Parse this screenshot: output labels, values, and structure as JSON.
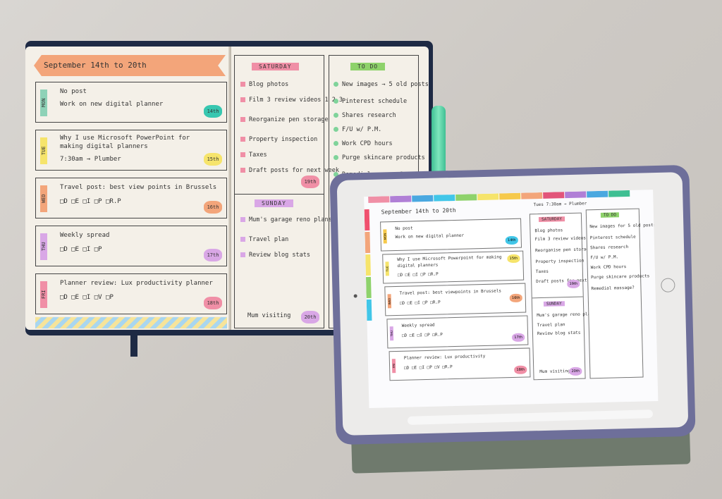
{
  "notebook": {
    "banner": "September 14th to 20th",
    "days": [
      {
        "tag": "MON",
        "color": "#8ed2b7",
        "lines": [
          "No post",
          "Work on new digital planner"
        ],
        "date": "14th",
        "dateColor": "#37c7b0"
      },
      {
        "tag": "TUE",
        "color": "#f6e46b",
        "lines": [
          "Why I use Microsoft PowerPoint for",
          "making digital planners",
          "7:30am → Plumber"
        ],
        "date": "15th",
        "dateColor": "#f6e46b"
      },
      {
        "tag": "WED",
        "color": "#f3a57a",
        "lines": [
          "Travel post: best view points in Brussels",
          "□D  □E  □I  □P  □R.P"
        ],
        "date": "16th",
        "dateColor": "#f3a57a"
      },
      {
        "tag": "THU",
        "color": "#d9a7e6",
        "lines": [
          "Weekly spread",
          "□D  □E  □I  □P"
        ],
        "date": "17th",
        "dateColor": "#d9a7e6"
      },
      {
        "tag": "FRI",
        "color": "#f08fa6",
        "lines": [
          "Planner review: Lux productivity planner",
          "□D  □E  □I  □V  □P"
        ],
        "date": "18th",
        "dateColor": "#f08fa6"
      }
    ],
    "saturday": {
      "title": "SATURDAY",
      "items": [
        "Blog photos",
        "Film 3 review videos  1 2 3",
        "Reorganize pen storage",
        "Property inspection",
        "Taxes",
        "Draft posts for next week"
      ],
      "date": "19th"
    },
    "sunday": {
      "title": "SUNDAY",
      "items": [
        "Mum's garage reno plans",
        "Travel plan",
        "Review blog stats"
      ],
      "note": "Mum visiting",
      "date": "20th"
    },
    "todo": {
      "title": "TO DO",
      "items": [
        "New images → 5 old posts",
        "Pinterest schedule",
        "Shares research",
        "F/U w/ P.M.",
        "Work CPD hours",
        "Purge skincare products",
        "Remedial massage?"
      ]
    }
  },
  "tablet": {
    "banner": "September 14th to 20th",
    "plumber": "Tues 7:30am → Plumber",
    "days": [
      {
        "tag": "MON",
        "color": "#f6c94b",
        "lines": [
          "No post",
          "Work on new digital planner"
        ],
        "date": "14th",
        "dateColor": "#41c6e8"
      },
      {
        "tag": "TUE",
        "color": "#f6e46b",
        "lines": [
          "Why I use Microsoft Powerpoint for making",
          "digital planners",
          "□D □E □I □P □R.P"
        ],
        "date": "15th",
        "dateColor": "#f6e46b"
      },
      {
        "tag": "WED",
        "color": "#f3a57a",
        "lines": [
          "Travel post: best viewpoints in Brussels",
          "□D □E □I □P □R.P"
        ],
        "date": "16th",
        "dateColor": "#f3a57a"
      },
      {
        "tag": "THU",
        "color": "#d9a7e6",
        "lines": [
          "Weekly spread",
          "□D □E □I □P □R.P"
        ],
        "date": "17th",
        "dateColor": "#d9a7e6"
      },
      {
        "tag": "FRI",
        "color": "#f08fa6",
        "lines": [
          "Planner review: Lux productivity",
          "□D □E □I □P □V □R.P"
        ],
        "date": "18th",
        "dateColor": "#f08fa6"
      }
    ],
    "saturday": {
      "title": "SATURDAY",
      "items": [
        "Blog photos",
        "Film 3 review videos",
        "Reorganise pen storage",
        "Property inspection",
        "Taxes",
        "Draft posts for next week"
      ],
      "date": "19th"
    },
    "sunday": {
      "title": "SUNDAY",
      "items": [
        "Mum's garage reno plans",
        "Travel plan",
        "Review blog stats"
      ],
      "note": "Mum visiting",
      "date": "20th"
    },
    "todo": {
      "title": "TO DO",
      "items": [
        "New images for 5 old posts",
        "Pinterest schedule",
        "Shares research",
        "F/U w/ P.M.",
        "Work CPD hours",
        "Purge skincare products",
        "Remedial massage?"
      ]
    },
    "tabColors": [
      "#f08fa6",
      "#b07fd6",
      "#4aa8e0",
      "#41c6e8",
      "#8ed26b",
      "#f6e46b",
      "#f6c94b",
      "#f3a57a",
      "#e2557a",
      "#b07fd6",
      "#4aa8e0",
      "#3fbf93"
    ],
    "sideColors": [
      "#f0506e",
      "#f3a57a",
      "#f6e46b",
      "#8ed26b",
      "#41c6e8"
    ]
  }
}
